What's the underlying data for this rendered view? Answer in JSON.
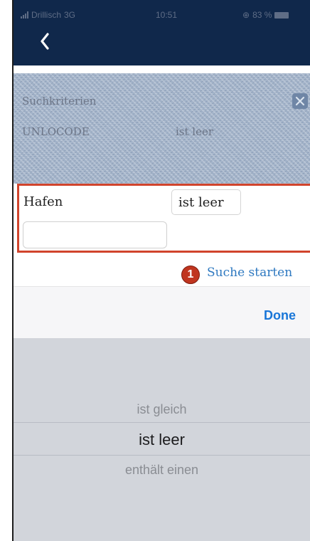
{
  "status_bar": {
    "carrier": "Drillisch",
    "network": "3G",
    "time": "10:51",
    "battery": "83 %"
  },
  "nav": {
    "back_icon": "chevron-left-icon"
  },
  "criteria": {
    "title": "Suchkriterien",
    "field": "UNLOCODE",
    "operator": "ist leer",
    "clear_icon": "clear-filter-icon"
  },
  "filter": {
    "field_label": "Hafen",
    "operator": "ist leer",
    "value": "",
    "placeholder": ""
  },
  "callout": {
    "number": "1"
  },
  "search_link": "Suche starten",
  "toolbar": {
    "done_label": "Done"
  },
  "picker": {
    "options": [
      "ist gleich",
      "ist leer",
      "enthält einen"
    ],
    "selected": "ist leer"
  },
  "colors": {
    "nav_bg": "#10284b",
    "highlight_border": "#d1442c",
    "link": "#2d78c0",
    "done": "#1976d8",
    "callout": "#c0351f"
  }
}
